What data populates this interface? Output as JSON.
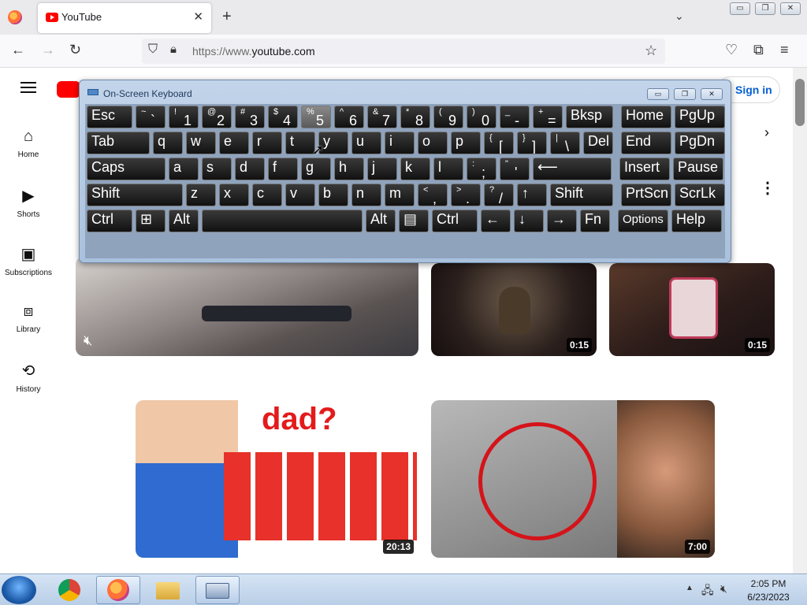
{
  "browser": {
    "tab_title": "YouTube",
    "tab_close": "✕",
    "new_tab": "+",
    "url_prefix": "https://www.",
    "url_domain": "youtube.com"
  },
  "window_controls": {
    "minimize": "▭",
    "restore": "❐",
    "close": "✕"
  },
  "youtube": {
    "signin_label": "Sign in",
    "sidebar": [
      {
        "label": "Home",
        "icon": "home-icon"
      },
      {
        "label": "Shorts",
        "icon": "shorts-icon"
      },
      {
        "label": "Subscriptions",
        "icon": "subscriptions-icon"
      },
      {
        "label": "Library",
        "icon": "library-icon"
      },
      {
        "label": "History",
        "icon": "history-icon"
      }
    ],
    "thumbnails": [
      {
        "duration": ""
      },
      {
        "duration": "0:15"
      },
      {
        "duration": "0:15"
      },
      {
        "duration": "20:13",
        "overlay_text": "dad?"
      },
      {
        "duration": "7:00"
      }
    ]
  },
  "osk": {
    "title": "On-Screen Keyboard",
    "rows": [
      [
        {
          "label": "Esc"
        },
        {
          "shift": "~",
          "main": "`"
        },
        {
          "shift": "!",
          "main": "1"
        },
        {
          "shift": "@",
          "main": "2"
        },
        {
          "shift": "#",
          "main": "3"
        },
        {
          "shift": "$",
          "main": "4"
        },
        {
          "shift": "%",
          "main": "5"
        },
        {
          "shift": "^",
          "main": "6"
        },
        {
          "shift": "&",
          "main": "7"
        },
        {
          "shift": "*",
          "main": "8"
        },
        {
          "shift": "(",
          "main": "9"
        },
        {
          "shift": ")",
          "main": "0"
        },
        {
          "shift": "_",
          "main": "-"
        },
        {
          "shift": "+",
          "main": "="
        },
        {
          "label": "Bksp"
        },
        {
          "label": "Home"
        },
        {
          "label": "PgUp"
        }
      ],
      [
        {
          "label": "Tab"
        },
        {
          "label": "q"
        },
        {
          "label": "w"
        },
        {
          "label": "e"
        },
        {
          "label": "r"
        },
        {
          "label": "t"
        },
        {
          "label": "y"
        },
        {
          "label": "u"
        },
        {
          "label": "i"
        },
        {
          "label": "o"
        },
        {
          "label": "p"
        },
        {
          "shift": "{",
          "main": "["
        },
        {
          "shift": "}",
          "main": "]"
        },
        {
          "shift": "|",
          "main": "\\"
        },
        {
          "label": "Del"
        },
        {
          "label": "End"
        },
        {
          "label": "PgDn"
        }
      ],
      [
        {
          "label": "Caps"
        },
        {
          "label": "a"
        },
        {
          "label": "s"
        },
        {
          "label": "d"
        },
        {
          "label": "f"
        },
        {
          "label": "g"
        },
        {
          "label": "h"
        },
        {
          "label": "j"
        },
        {
          "label": "k"
        },
        {
          "label": "l"
        },
        {
          "shift": ":",
          "main": ";"
        },
        {
          "shift": "\"",
          "main": "'"
        },
        {
          "label": "⟵"
        },
        {
          "label": "Insert"
        },
        {
          "label": "Pause"
        }
      ],
      [
        {
          "label": "Shift"
        },
        {
          "label": "z"
        },
        {
          "label": "x"
        },
        {
          "label": "c"
        },
        {
          "label": "v"
        },
        {
          "label": "b"
        },
        {
          "label": "n"
        },
        {
          "label": "m"
        },
        {
          "shift": "<",
          "main": ","
        },
        {
          "shift": ">",
          "main": "."
        },
        {
          "shift": "?",
          "main": "/"
        },
        {
          "label": "↑"
        },
        {
          "label": "Shift"
        },
        {
          "label": "PrtScn"
        },
        {
          "label": "ScrLk"
        }
      ],
      [
        {
          "label": "Ctrl"
        },
        {
          "label": "⊞"
        },
        {
          "label": "Alt"
        },
        {
          "label": ""
        },
        {
          "label": "Alt"
        },
        {
          "label": "▤"
        },
        {
          "label": "Ctrl"
        },
        {
          "label": "←"
        },
        {
          "label": "↓"
        },
        {
          "label": "→"
        },
        {
          "label": "Fn"
        },
        {
          "label": "Options"
        },
        {
          "label": "Help"
        }
      ]
    ],
    "pressed_key": "5"
  },
  "taskbar": {
    "time": "2:05 PM",
    "date": "6/23/2023",
    "apps": [
      "windows-start",
      "chrome",
      "firefox",
      "file-explorer",
      "on-screen-keyboard"
    ]
  }
}
